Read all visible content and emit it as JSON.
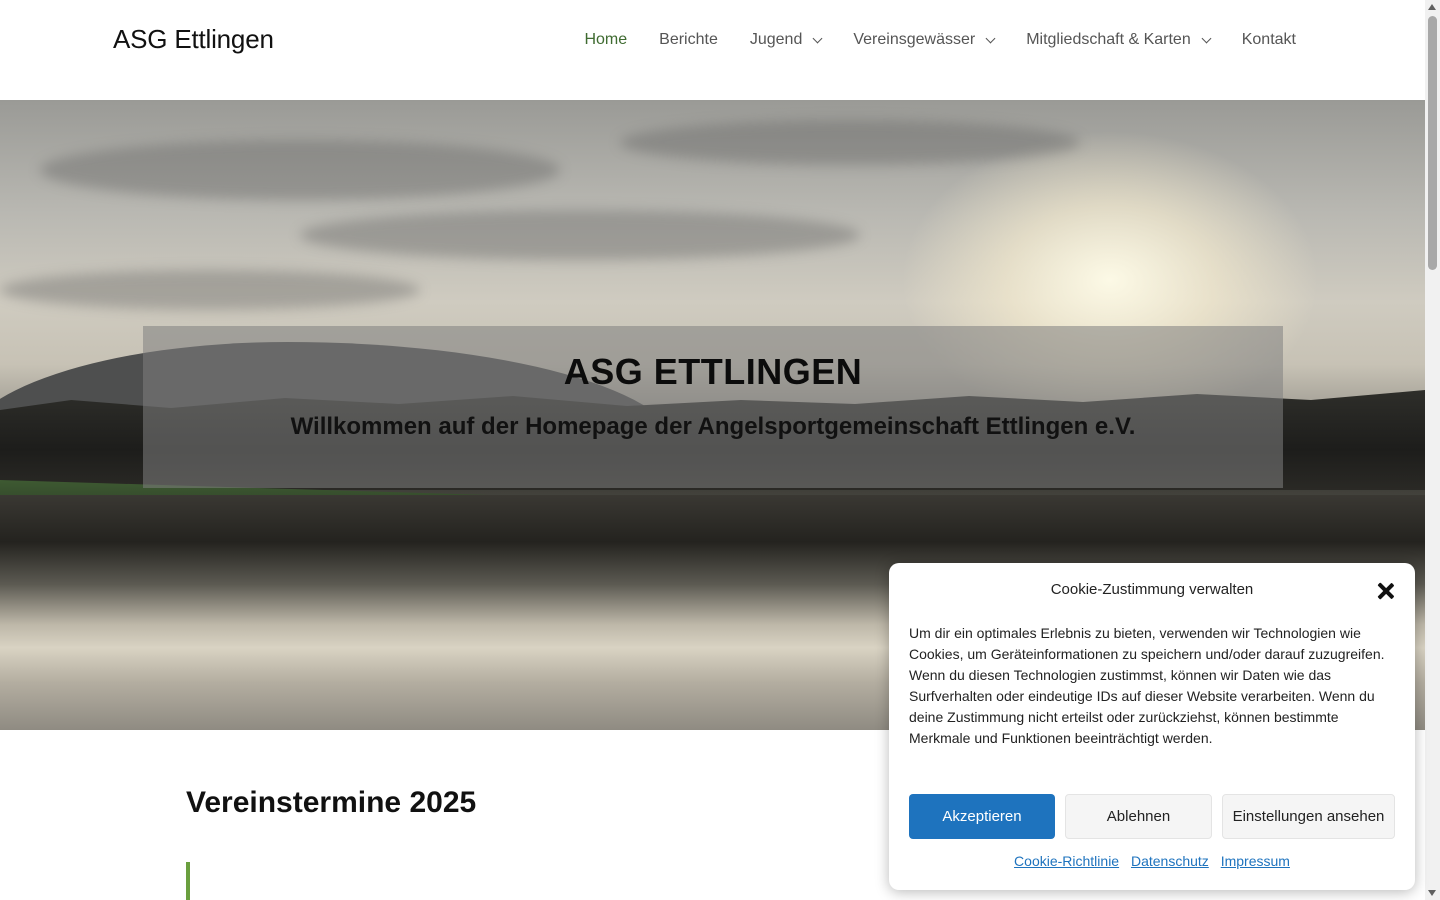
{
  "header": {
    "site_title": "ASG Ettlingen",
    "nav": [
      {
        "label": "Home",
        "active": true,
        "has_dropdown": false
      },
      {
        "label": "Berichte",
        "active": false,
        "has_dropdown": false
      },
      {
        "label": "Jugend",
        "active": false,
        "has_dropdown": true
      },
      {
        "label": "Vereinsgewässer",
        "active": false,
        "has_dropdown": true
      },
      {
        "label": "Mitgliedschaft & Karten",
        "active": false,
        "has_dropdown": true
      },
      {
        "label": "Kontakt",
        "active": false,
        "has_dropdown": false
      }
    ]
  },
  "hero": {
    "title": "ASG ETTLINGEN",
    "subtitle": "Willkommen auf der Homepage der Angelsportgemeinschaft Ettlingen e.V."
  },
  "content": {
    "section_title": "Vereinstermine 2025"
  },
  "cookie_banner": {
    "title": "Cookie-Zustimmung verwalten",
    "text": "Um dir ein optimales Erlebnis zu bieten, verwenden wir Technologien wie Cookies, um Geräteinformationen zu speichern und/oder darauf zuzugreifen. Wenn du diesen Technologien zustimmst, können wir Daten wie das Surfverhalten oder eindeutige IDs auf dieser Website verarbeiten. Wenn du deine Zustimmung nicht erteilst oder zurückziehst, können bestimmte Merkmale und Funktionen beeinträchtigt werden.",
    "accept_label": "Akzeptieren",
    "deny_label": "Ablehnen",
    "settings_label": "Einstellungen ansehen",
    "links": [
      "Cookie-Richtlinie",
      "Datenschutz",
      "Impressum"
    ]
  },
  "colors": {
    "nav_active": "#3f6b31",
    "accent_button": "#1e73be",
    "quote_bar": "#6a9f3e"
  }
}
